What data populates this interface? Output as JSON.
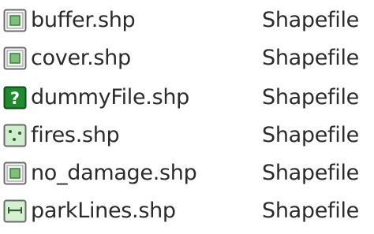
{
  "files": [
    {
      "name": "buffer.shp",
      "type": "Shapefile",
      "icon": "polygon-shapefile-icon"
    },
    {
      "name": "cover.shp",
      "type": "Shapefile",
      "icon": "polygon-shapefile-icon"
    },
    {
      "name": "dummyFile.shp",
      "type": "Shapefile",
      "icon": "unknown-shapefile-icon"
    },
    {
      "name": "fires.shp",
      "type": "Shapefile",
      "icon": "point-shapefile-icon"
    },
    {
      "name": "no_damage.shp",
      "type": "Shapefile",
      "icon": "polygon-shapefile-icon"
    },
    {
      "name": "parkLines.shp",
      "type": "Shapefile",
      "icon": "line-shapefile-icon"
    }
  ],
  "colors": {
    "text": "#2b2b2b",
    "polygon_icon_fill": "#7ec07a",
    "point_icon_fill": "#cfeecb",
    "line_icon_fill": "#d6f0d2",
    "unknown_icon_fill": "#1f8a2e"
  }
}
